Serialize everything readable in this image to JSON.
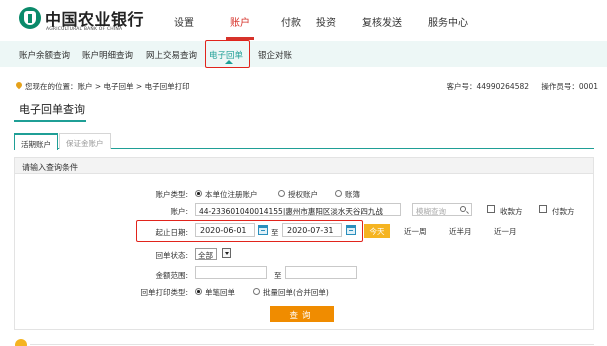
{
  "header": {
    "brand_cn": "中国农业银行",
    "brand_en": "AGRICULTURAL BANK OF CHINA",
    "nav": [
      {
        "label": "设置"
      },
      {
        "label": "账户"
      },
      {
        "label": "付款"
      },
      {
        "label": "投资"
      },
      {
        "label": "复核发送"
      },
      {
        "label": "服务中心"
      }
    ],
    "active_nav": "账户"
  },
  "subnav": {
    "items": [
      {
        "label": "账户余额查询"
      },
      {
        "label": "账户明细查询"
      },
      {
        "label": "网上交易查询"
      },
      {
        "label": "电子回单"
      },
      {
        "label": "银企对账"
      }
    ],
    "active": "电子回单"
  },
  "breadcrumb": "您现在的位置：账户 > 电子回单 > 电子回单打印",
  "account_info": {
    "customer_no": "客户号：44990264582",
    "operator_no": "操作员号：0001"
  },
  "page_title": "电子回单查询",
  "tabs": [
    {
      "label": "活期账户"
    },
    {
      "label": "保证金账户"
    }
  ],
  "panel": {
    "title": "请输入查询条件",
    "account_type": {
      "label": "账户类型:",
      "options": [
        "本单位注册账户",
        "授权账户",
        "账簿"
      ],
      "selected": "本单位注册账户"
    },
    "account": {
      "label": "账户:",
      "value": "44-233601040014155|惠州市惠阳区淡水天谷四九战",
      "search_placeholder": "模糊查询",
      "checkbox_receiver": "收款方",
      "checkbox_payer": "付款方"
    },
    "date": {
      "label": "起止日期:",
      "start": "2020-06-01",
      "to": "至",
      "end": "2020-07-31",
      "today": "今天",
      "quick": [
        "近一周",
        "近半月",
        "近一月"
      ]
    },
    "receipt_status": {
      "label": "回单状态:",
      "value": "全部"
    },
    "amount_range": {
      "label": "金额范围:",
      "to": "至"
    },
    "print_type": {
      "label": "回单打印类型:",
      "options": [
        "单笔回单",
        "批量回单(合并回单)"
      ],
      "selected": "单笔回单"
    },
    "query_button": "查询"
  },
  "colors": {
    "brand_green": "#1f9f96",
    "active_red": "#d6322a",
    "highlight_red": "#e1241c",
    "today_yellow": "#f5b421",
    "query_orange": "#f08c00"
  }
}
